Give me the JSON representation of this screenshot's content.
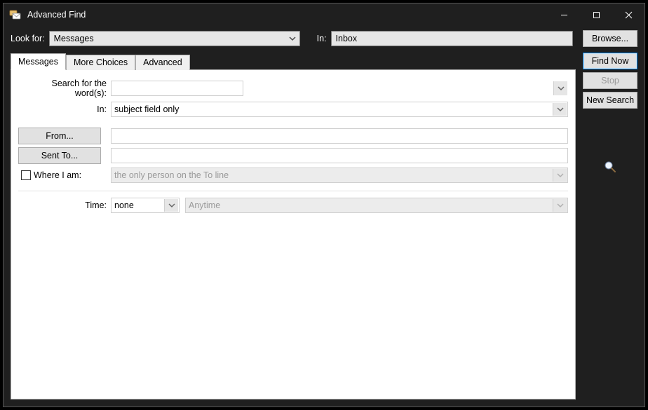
{
  "window": {
    "title": "Advanced Find"
  },
  "toprow": {
    "lookfor_label": "Look for:",
    "lookfor_value": "Messages",
    "in_label": "In:",
    "in_value": "Inbox",
    "browse_label": "Browse..."
  },
  "tabs": {
    "messages": "Messages",
    "more_choices": "More Choices",
    "advanced": "Advanced"
  },
  "form": {
    "search_words_label": "Search for the word(s):",
    "search_words_value": "",
    "in_label": "In:",
    "in_value": "subject field only",
    "from_label": "From...",
    "from_value": "",
    "sent_to_label": "Sent To...",
    "sent_to_value": "",
    "where_label": "Where I am:",
    "where_value": "the only person on the To line",
    "time_label": "Time:",
    "time_select_value": "none",
    "time_range_value": "Anytime"
  },
  "sidebar": {
    "find_now": "Find Now",
    "stop": "Stop",
    "new_search": "New Search"
  }
}
